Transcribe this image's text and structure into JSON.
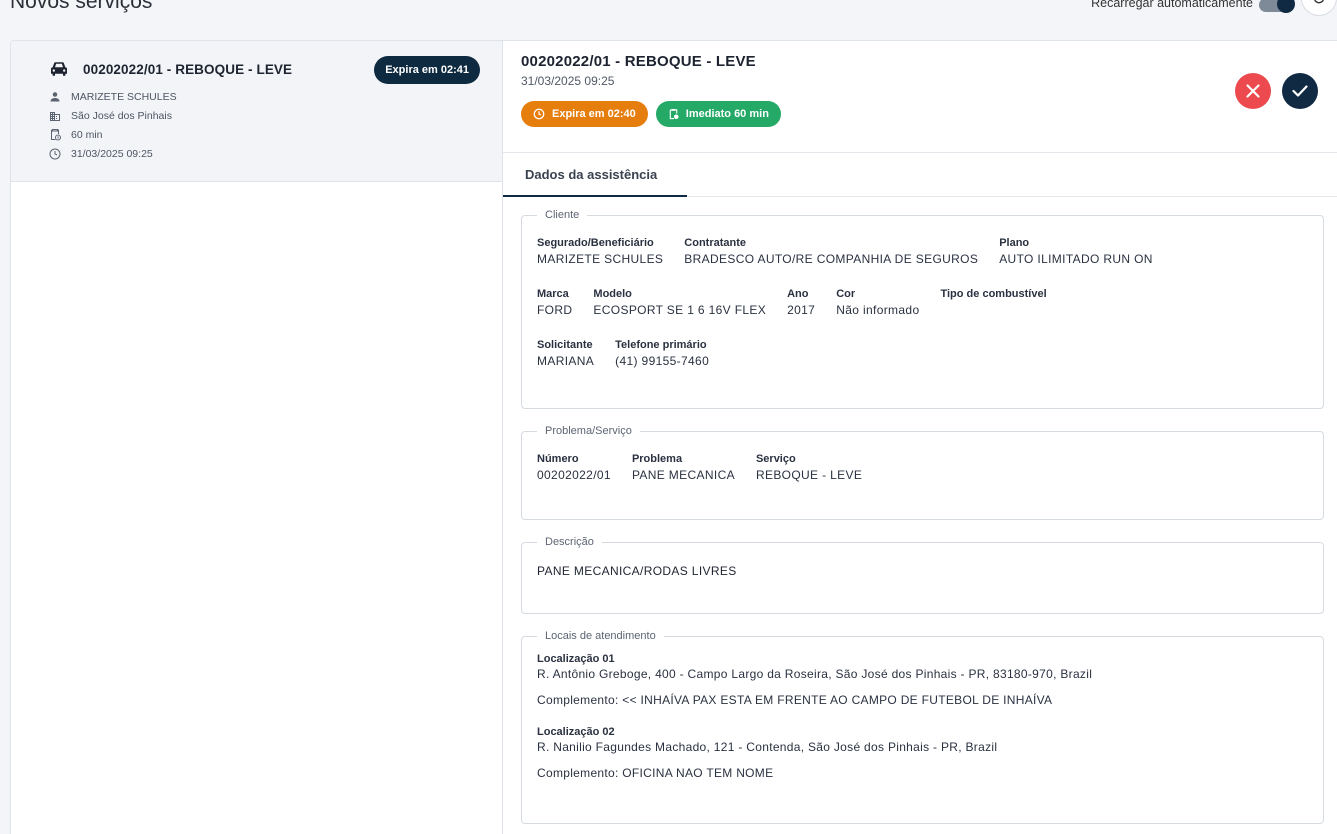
{
  "header": {
    "title": "Novos serviços",
    "auto_reload_label": "Recarregar automaticamente"
  },
  "list_card": {
    "title": "00202022/01 - REBOQUE - LEVE",
    "expire": "Expira em 02:41",
    "client": "MARIZETE SCHULES",
    "city": "São José dos Pinhais",
    "duration": "60 min",
    "datetime": "31/03/2025 09:25"
  },
  "detail": {
    "title": "00202022/01 - REBOQUE - LEVE",
    "date": "31/03/2025 09:25",
    "expire_chip": "Expira em 02:40",
    "immediate_chip": "Imediato 60 min"
  },
  "tabs": {
    "data_tab": "Dados da assistência"
  },
  "cliente": {
    "legend": "Cliente",
    "segurado_label": "Segurado/Beneficiário",
    "segurado_value": "MARIZETE SCHULES",
    "contratante_label": "Contratante",
    "contratante_value": "BRADESCO AUTO/RE COMPANHIA DE SEGUROS",
    "plano_label": "Plano",
    "plano_value": "AUTO ILIMITADO RUN ON",
    "marca_label": "Marca",
    "marca_value": "FORD",
    "modelo_label": "Modelo",
    "modelo_value": "ECOSPORT SE 1 6 16V FLEX",
    "ano_label": "Ano",
    "ano_value": "2017",
    "cor_label": "Cor",
    "cor_value": "Não informado",
    "combustivel_label": "Tipo de combustível",
    "solicitante_label": "Solicitante",
    "solicitante_value": "MARIANA",
    "telefone_label": "Telefone primário",
    "telefone_value": "(41) 99155-7460"
  },
  "problema": {
    "legend": "Problema/Serviço",
    "numero_label": "Número",
    "numero_value": "00202022/01",
    "problema_label": "Problema",
    "problema_value": "PANE MECANICA",
    "servico_label": "Serviço",
    "servico_value": "REBOQUE - LEVE"
  },
  "descricao": {
    "legend": "Descrição",
    "value": "PANE MECANICA/RODAS LIVRES"
  },
  "locais": {
    "legend": "Locais de atendimento",
    "loc1_label": "Localização 01",
    "loc1_address": "R. Antônio Greboge, 400 - Campo Largo da Roseira, São José dos Pinhais - PR, 83180-970, Brazil",
    "loc1_complement": "Complemento: << INHAÍVA PAX ESTA EM FRENTE AO CAMPO DE FUTEBOL DE INHAÍVA",
    "loc2_label": "Localização 02",
    "loc2_address": "R. Nanilio Fagundes Machado, 121 - Contenda, São José dos Pinhais - PR, Brazil",
    "loc2_complement": "Complemento: OFICINA NAO TEM NOME"
  },
  "colors": {
    "primary": "#102a43",
    "danger": "#ec4a4f",
    "warning": "#e67e0e",
    "success": "#24a966"
  }
}
